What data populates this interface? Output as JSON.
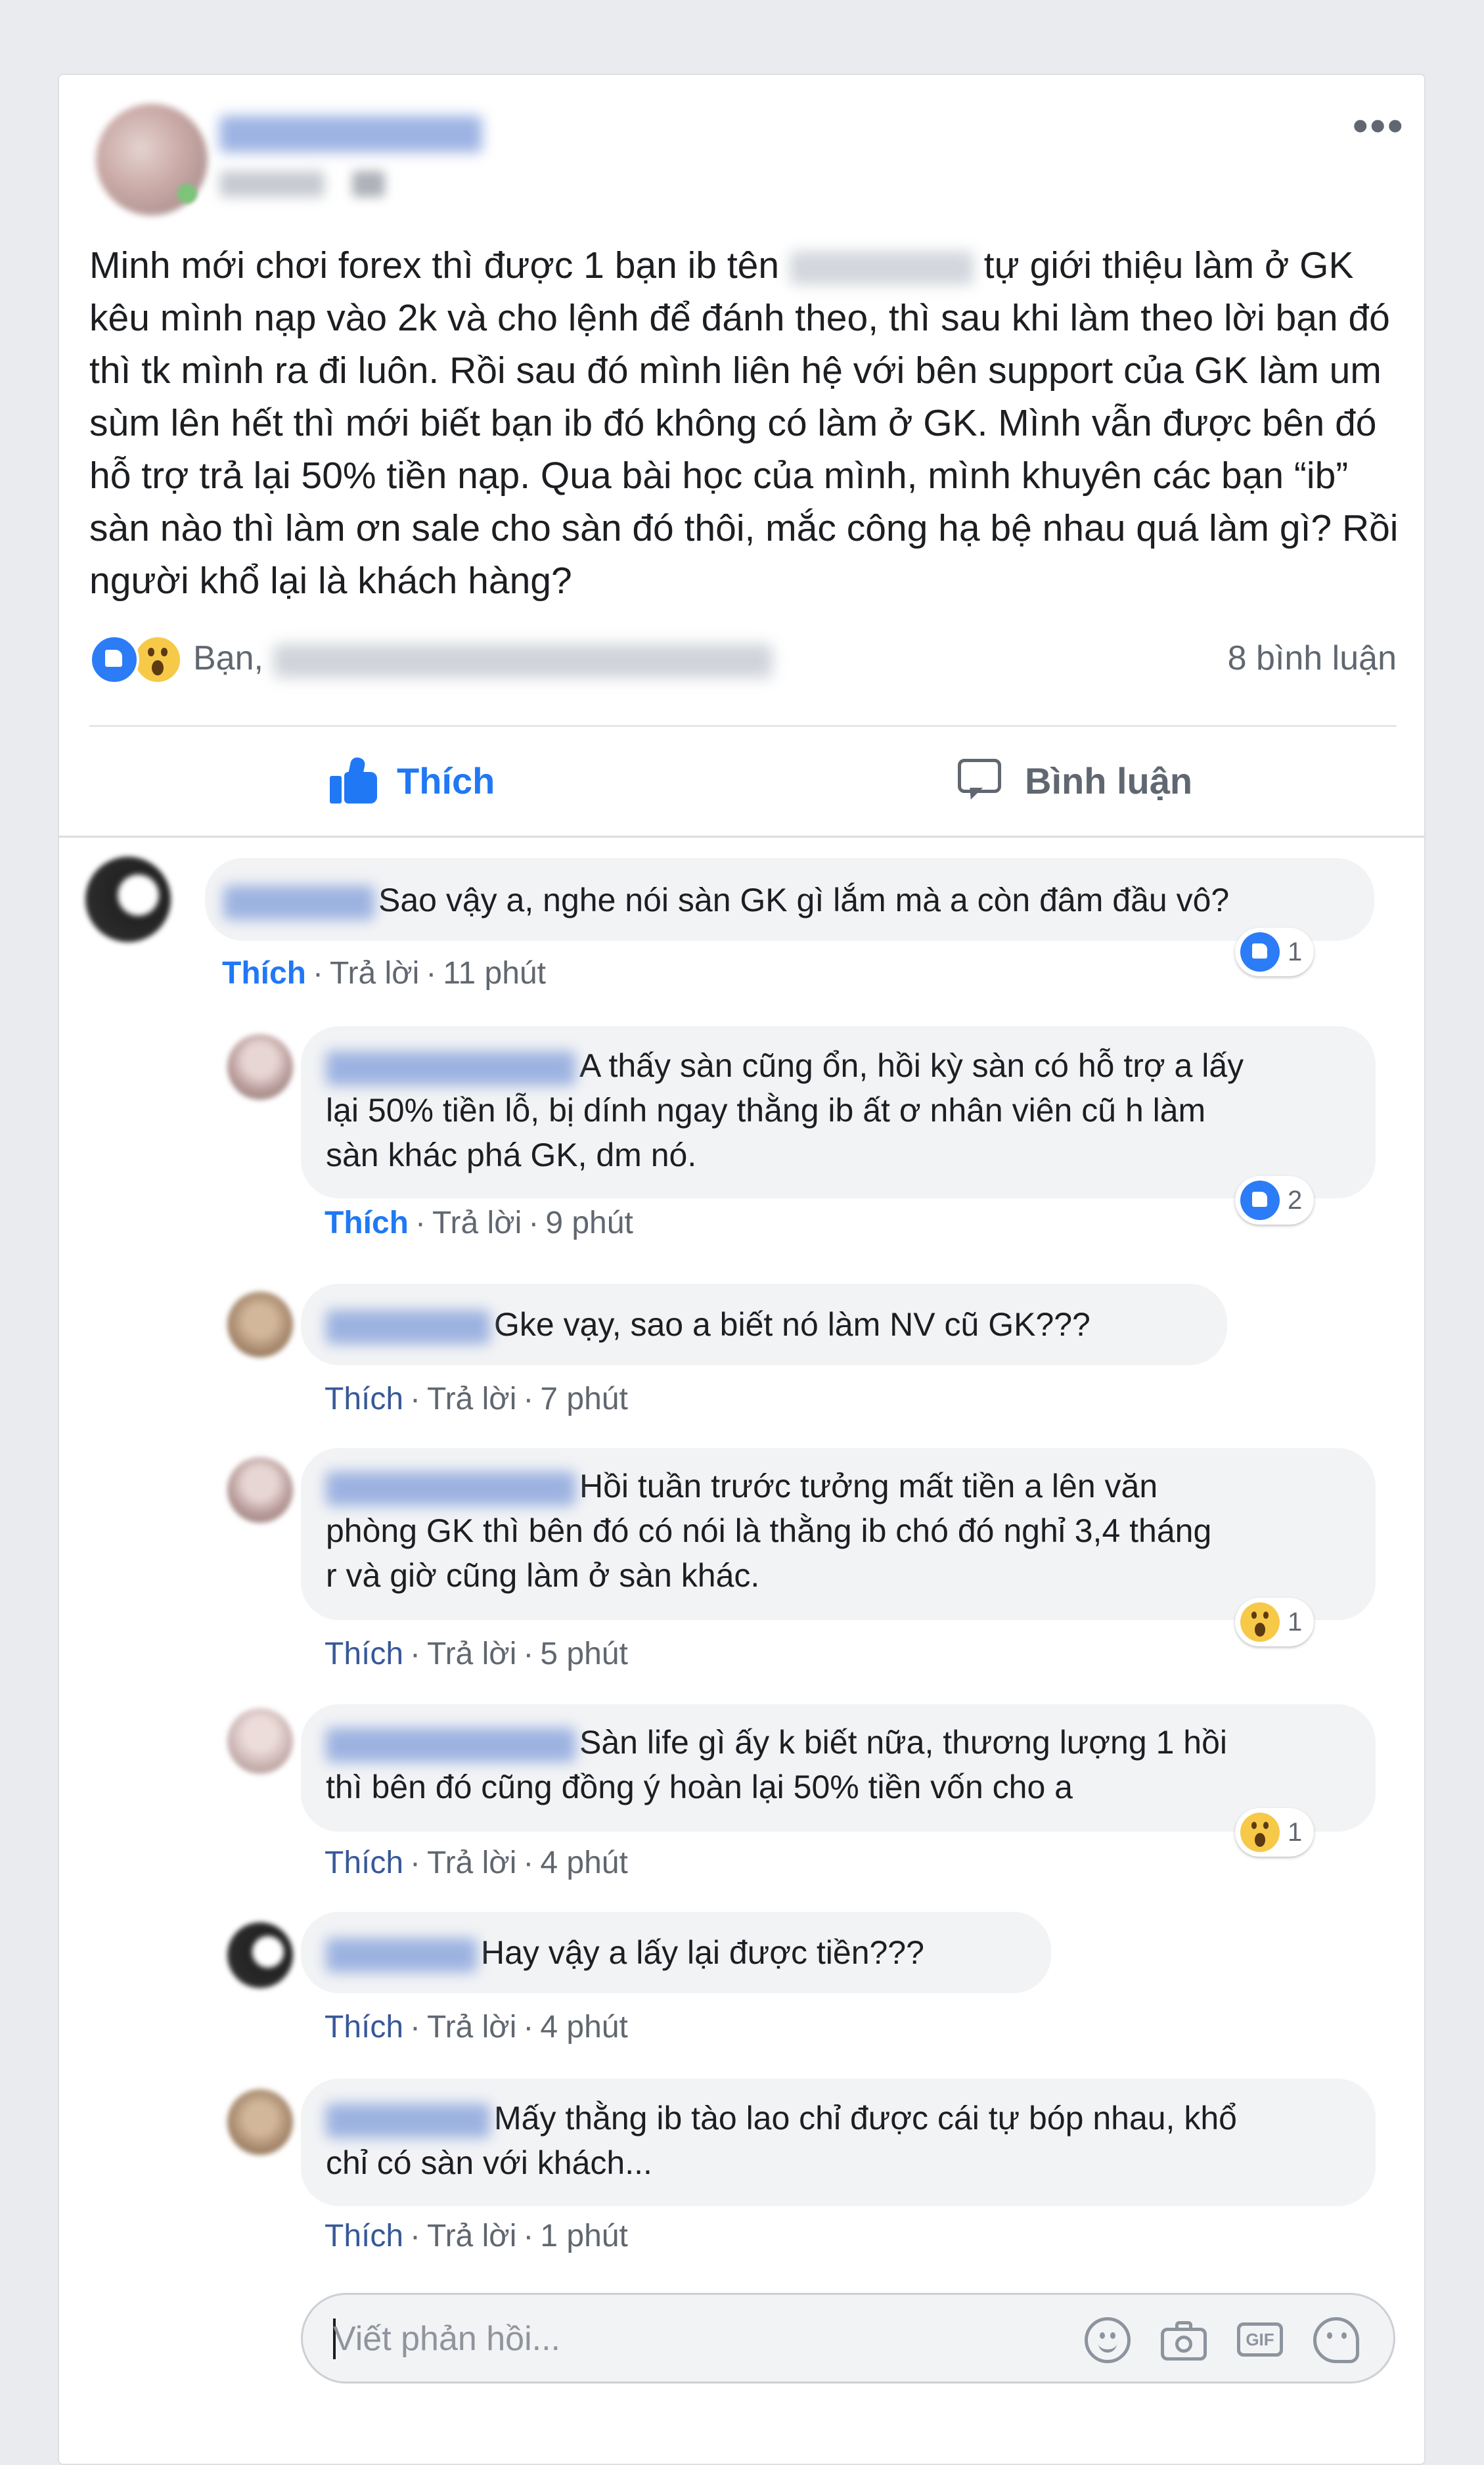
{
  "post": {
    "text_before": "Minh mới chơi forex thì được 1 bạn ib tên ",
    "text_after": " tự giới thiệu làm ở GK kêu mình nạp vào 2k và cho lệnh để đánh theo, thì sau khi làm theo lời bạn đó thì tk mình ra đi luôn. Rồi sau đó mình liên hệ với bên support của GK làm um sùm lên hết thì mới biết bạn ib đó không có làm ở GK. Mình vẫn được bên đó hỗ trợ trả lại 50% tiền nạp. Qua bài học của mình, mình khuyên các bạn “ib” sàn nào thì làm ơn sale cho sàn đó thôi, mắc công hạ bệ nhau quá làm gì? Rồi người khổ lại là khách hàng?",
    "more_label": "•••",
    "reactions_prefix": "Bạn,",
    "comment_count": "8 bình luận",
    "like_label": "Thích",
    "comment_label": "Bình luận"
  },
  "comments": [
    {
      "text": "Sao vậy a, nghe nói sàn GK gì lắm mà a còn đâm đầu vô?",
      "like": "Thích",
      "reply": "Trả lời",
      "time": "11 phút",
      "reaction_count": "1",
      "reaction": "like",
      "liked": true
    },
    {
      "text": "A thấy sàn cũng ổn, hồi kỳ sàn có hỗ trợ a lấy\nlại 50% tiền lỗ, bị dính ngay thằng ib ất ơ nhân viên cũ h làm\nsàn khác phá GK, dm nó.",
      "like": "Thích",
      "reply": "Trả lời",
      "time": "9 phút",
      "reaction_count": "2",
      "reaction": "like",
      "liked": true
    },
    {
      "text": "Gke vạy, sao a biết nó làm NV cũ GK???",
      "like": "Thích",
      "reply": "Trả lời",
      "time": "7 phút"
    },
    {
      "text": "Hồi tuần trước tưởng mất tiền a lên văn\nphòng GK thì bên đó có nói là thằng ib chó đó nghỉ 3,4 tháng\nr và giờ cũng làm ở sàn khác.",
      "like": "Thích",
      "reply": "Trả lời",
      "time": "5 phút",
      "reaction_count": "1",
      "reaction": "wow"
    },
    {
      "text": "Sàn life gì ấy k biết nữa, thương lượng 1 hồi\nthì bên đó cũng đồng ý hoàn lại 50% tiền vốn cho a",
      "like": "Thích",
      "reply": "Trả lời",
      "time": "4 phút",
      "reaction_count": "1",
      "reaction": "wow"
    },
    {
      "text": "Hay vậy a lấy lại được tiền???",
      "like": "Thích",
      "reply": "Trả lời",
      "time": "4 phút"
    },
    {
      "text": "Mấy thằng ib tào lao chỉ được cái tự bóp nhau, khổ\nchỉ có sàn với khách...",
      "like": "Thích",
      "reply": "Trả lời",
      "time": "1 phút"
    }
  ],
  "reply_box": {
    "placeholder": "Viết phản hồi...",
    "gif_label": "GIF"
  },
  "colors": {
    "accent": "#2078f4",
    "page_bg": "#e9ebee",
    "bubble_bg": "#f2f3f5"
  },
  "icons": [
    "more-icon",
    "like-reaction-icon",
    "wow-reaction-icon",
    "thumb-up-icon",
    "comment-icon",
    "emoji-icon",
    "camera-icon",
    "gif-icon",
    "sticker-icon"
  ]
}
